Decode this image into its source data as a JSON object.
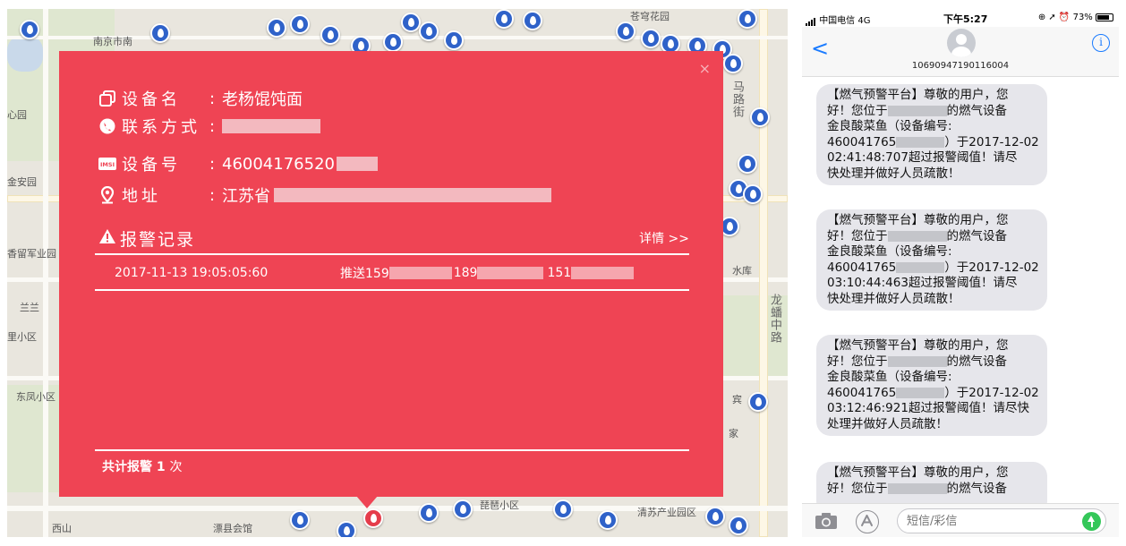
{
  "map": {
    "labels": [
      "南京市南",
      "苍穹花园",
      "心园",
      "金安园",
      "香留军业园",
      "兰兰",
      "里小区",
      "东凤小区",
      "马路街",
      "水库",
      "龙蟠中路",
      "宾",
      "家",
      "琵琶小区",
      "清苏产业园区",
      "西山",
      "漂县会馆"
    ],
    "accent_red": "#ef4454",
    "pin_color": "#2f62c9"
  },
  "popup": {
    "close_label": "×",
    "device_name_key": "设备名",
    "device_name_value": "老杨馄饨面",
    "contact_key": "联系方式",
    "device_no_key": "设备号",
    "device_no_value": "46004176520",
    "address_key": "地址",
    "address_value": "江苏省",
    "colon": ":",
    "alarm_title": "报警记录",
    "alarm_detail_link": "详情 >>",
    "alarm_records": [
      {
        "time": "2017-11-13 19:05:05:60",
        "push_prefix": "推送159",
        "num2": "189",
        "num3": "151"
      }
    ],
    "total_text_prefix": "共计报警",
    "total_count": "1",
    "total_text_suffix": "次"
  },
  "phone": {
    "carrier": "中国电信  4G",
    "time": "下午5:27",
    "battery": "73%",
    "sender_number": "10690947190116004",
    "back_label": "<",
    "info_label": "i",
    "input_placeholder": "短信/彩信",
    "messages": [
      {
        "l1": "【燃气预警平台】尊敬的用户，您",
        "l2a": "好！您位于",
        "l2b": "的燃气设备",
        "l3": "金良酸菜鱼（设备编号:",
        "l4a": "460041765",
        "l4b": "）于2017-12-02",
        "l5": "02:41:48:707超过报警阈值！请尽",
        "l6": "快处理并做好人员疏散！"
      },
      {
        "l1": "【燃气预警平台】尊敬的用户，您",
        "l2a": "好！您位于",
        "l2b": "的燃气设备",
        "l3": "金良酸菜鱼（设备编号:",
        "l4a": "460041765",
        "l4b": "）于2017-12-02",
        "l5": "03:10:44:463超过报警阈值！请尽",
        "l6": "快处理并做好人员疏散！"
      },
      {
        "l1": "【燃气预警平台】尊敬的用户，您",
        "l2a": "好！您位于",
        "l2b": "的燃气设备",
        "l3": "金良酸菜鱼（设备编号:",
        "l4a": "460041765",
        "l4b": "）于2017-12-02",
        "l5": "03:12:46:921超过报警阈值！请尽快",
        "l6": "处理并做好人员疏散！"
      },
      {
        "l1": "【燃气预警平台】尊敬的用户，您",
        "l2a": "好！您位于",
        "l2b": "的燃气设备"
      }
    ]
  }
}
